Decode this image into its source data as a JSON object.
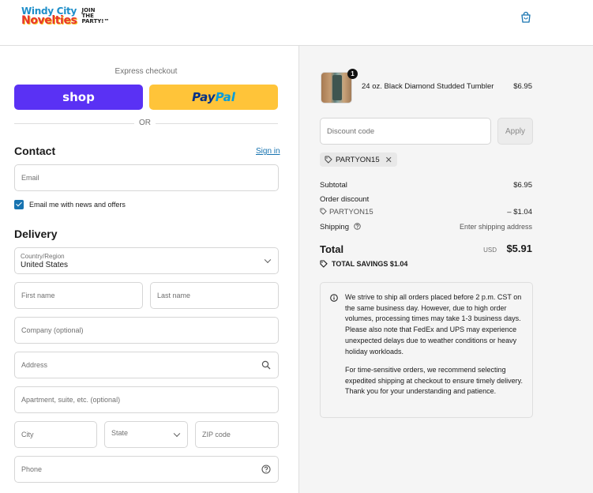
{
  "header": {
    "logo_line1": "Windy City",
    "logo_line2": "Novelties",
    "logo_side1": "JOIN",
    "logo_side2": "THE",
    "logo_side3": "PARTY!™",
    "cart_icon": "shopping-bag-icon"
  },
  "express": {
    "label": "Express checkout",
    "shop_label": "shop",
    "paypal_part1": "Pay",
    "paypal_part2": "Pal",
    "or_label": "OR"
  },
  "contact": {
    "title": "Contact",
    "signin_label": "Sign in",
    "email_placeholder": "Email",
    "newsletter_label": "Email me with news and offers",
    "newsletter_checked": true
  },
  "delivery": {
    "title": "Delivery",
    "country_label": "Country/Region",
    "country_value": "United States",
    "first_name_placeholder": "First name",
    "last_name_placeholder": "Last name",
    "company_placeholder": "Company (optional)",
    "address_placeholder": "Address",
    "apartment_placeholder": "Apartment, suite, etc. (optional)",
    "city_placeholder": "City",
    "state_placeholder": "State",
    "zip_placeholder": "ZIP code",
    "phone_placeholder": "Phone"
  },
  "order": {
    "item": {
      "quantity": "1",
      "name": "24 oz. Black Diamond Studded Tumbler",
      "price": "$6.95"
    },
    "discount_placeholder": "Discount code",
    "apply_label": "Apply",
    "applied_code": "PARTYON15",
    "subtotal_label": "Subtotal",
    "subtotal_value": "$6.95",
    "order_discount_label": "Order discount",
    "discount_code": "PARTYON15",
    "discount_value": "– $1.04",
    "shipping_label": "Shipping",
    "shipping_value": "Enter shipping address",
    "total_label": "Total",
    "currency": "USD",
    "total_value": "$5.91",
    "savings_label": "TOTAL SAVINGS",
    "savings_value": "$1.04"
  },
  "notice": {
    "paragraph1": "We strive to ship all orders placed before 2 p.m. CST on the same business day. However, due to high order volumes, processing times may take 1-3 business days. Please also note that FedEx and UPS may experience unexpected delays due to weather conditions or heavy holiday workloads.",
    "paragraph2": "For time-sensitive orders, we recommend selecting expedited shipping at checkout to ensure timely delivery. Thank you for your understanding and patience."
  },
  "colors": {
    "shop_purple": "#5a31f4",
    "paypal_yellow": "#ffc439",
    "link_blue": "#1773b0",
    "panel_grey": "#f5f5f5"
  }
}
